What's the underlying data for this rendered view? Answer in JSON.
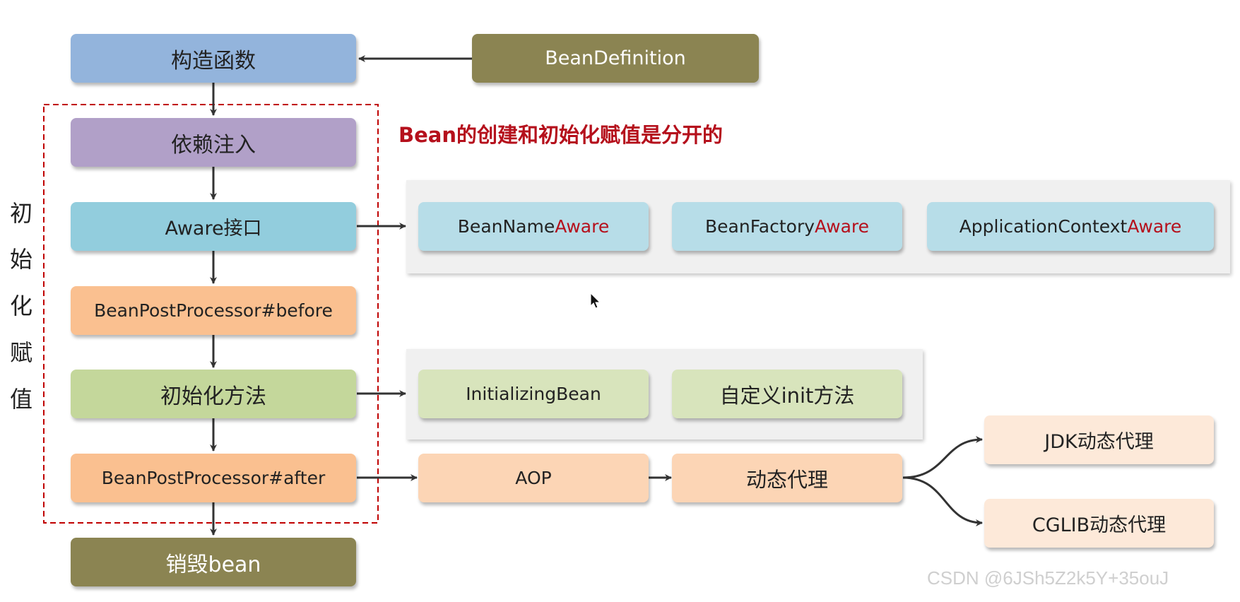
{
  "left_label": [
    "初",
    "始",
    "化",
    "赋",
    "值"
  ],
  "title_note": "Bean的创建和初始化赋值是分开的",
  "flow": {
    "constructor": "构造函数",
    "bean_definition": "BeanDefinition",
    "dependency_injection": "依赖注入",
    "aware_interface": "Aware接口",
    "bpp_before": "BeanPostProcessor#before",
    "init_method": "初始化方法",
    "bpp_after": "BeanPostProcessor#after",
    "destroy_bean": "销毁bean"
  },
  "aware_items": [
    {
      "prefix": "BeanName",
      "suffix": "Aware"
    },
    {
      "prefix": "BeanFactory",
      "suffix": "Aware"
    },
    {
      "prefix": "ApplicationContext",
      "suffix": "Aware"
    }
  ],
  "init_items": [
    "InitializingBean",
    "自定义init方法"
  ],
  "aop": {
    "aop": "AOP",
    "dynamic_proxy": "动态代理",
    "jdk_proxy": "JDK动态代理",
    "cglib_proxy": "CGLIB动态代理"
  },
  "watermark": "CSDN @6JSh5Z2k5Y+35ouJ",
  "colors": {
    "constructor": "#93b4dc",
    "bean_definition": "#8b8452",
    "dependency_injection": "#b1a0c8",
    "aware": "#92cddd",
    "bpp": "#fac090",
    "init": "#c4d79b",
    "destroy": "#8b8452",
    "aware_items": "#b7dde8",
    "init_items": "#d8e4bc",
    "aop_items": "#fcd5b5",
    "proxy_items": "#fde9d9",
    "dashed_border": "#c00000",
    "accent_text": "#b5101c"
  }
}
